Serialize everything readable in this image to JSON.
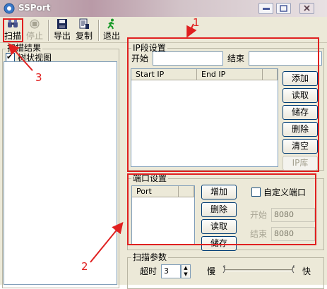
{
  "window": {
    "title": "SSPort"
  },
  "toolbar": {
    "items": [
      {
        "label": "扫描"
      },
      {
        "label": "停止"
      },
      {
        "label": "导出"
      },
      {
        "label": "复制"
      },
      {
        "label": "退出"
      }
    ]
  },
  "results": {
    "group_label": "扫描结果",
    "tree_view_label": "树状视图",
    "tree_view_checked": true
  },
  "ip_segment": {
    "group_label": "IP段设置",
    "start_label": "开始",
    "start_value": "",
    "end_label": "结束",
    "end_value": "",
    "columns": [
      "Start IP",
      "End IP"
    ],
    "buttons": [
      "添加",
      "读取",
      "储存",
      "删除",
      "清空",
      "IP库"
    ]
  },
  "port_settings": {
    "group_label": "端口设置",
    "columns": [
      "Port"
    ],
    "buttons": [
      "增加",
      "删除",
      "读取",
      "储存"
    ],
    "custom_port_label": "自定义端口",
    "custom_port_checked": false,
    "start_label": "开始",
    "start_value": "8080",
    "end_label": "结束",
    "end_value": "8080"
  },
  "scan_params": {
    "group_label": "扫描参数",
    "timeout_label": "超时",
    "timeout_value": "3",
    "slow_label": "慢",
    "fast_label": "快"
  },
  "annotations": {
    "box1_label": "1",
    "box2_label": "2",
    "box3_label": "3",
    "color": "#e02020"
  }
}
